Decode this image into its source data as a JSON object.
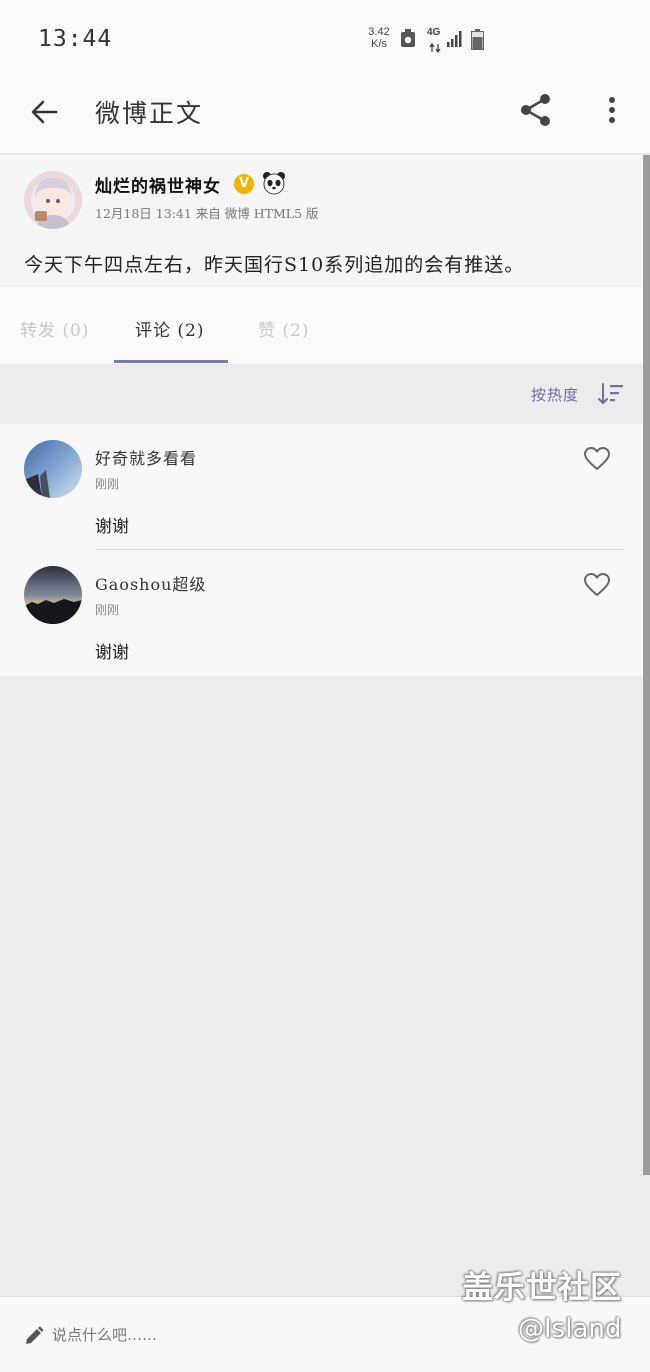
{
  "status_bar": {
    "time": "13:44",
    "net_speed_value": "3.42",
    "net_speed_unit": "K/s",
    "network_type": "4G"
  },
  "app_bar": {
    "title": "微博正文"
  },
  "post": {
    "author_name": "灿烂的祸世神女",
    "verified_mark": "V",
    "meta": "12月18日 13:41  来自 微博 HTML5 版",
    "text": "今天下午四点左右，昨天国行S10系列追加的会有推送。"
  },
  "tabs": [
    {
      "label": "转发 (0)",
      "active": false
    },
    {
      "label": "评论 (2)",
      "active": true
    },
    {
      "label": "赞 (2)",
      "active": false
    }
  ],
  "sort": {
    "label": "按热度"
  },
  "comments": [
    {
      "user": "好奇就多看看",
      "time": "刚刚",
      "text": "谢谢"
    },
    {
      "user": "Gaoshou超级",
      "time": "刚刚",
      "text": "谢谢"
    }
  ],
  "bottom_bar": {
    "placeholder": "说点什么吧……"
  },
  "watermark": {
    "main": "盖乐世社区",
    "sub": "@Island"
  },
  "colors": {
    "accent": "#7a79ad",
    "verified": "#f0b400"
  }
}
